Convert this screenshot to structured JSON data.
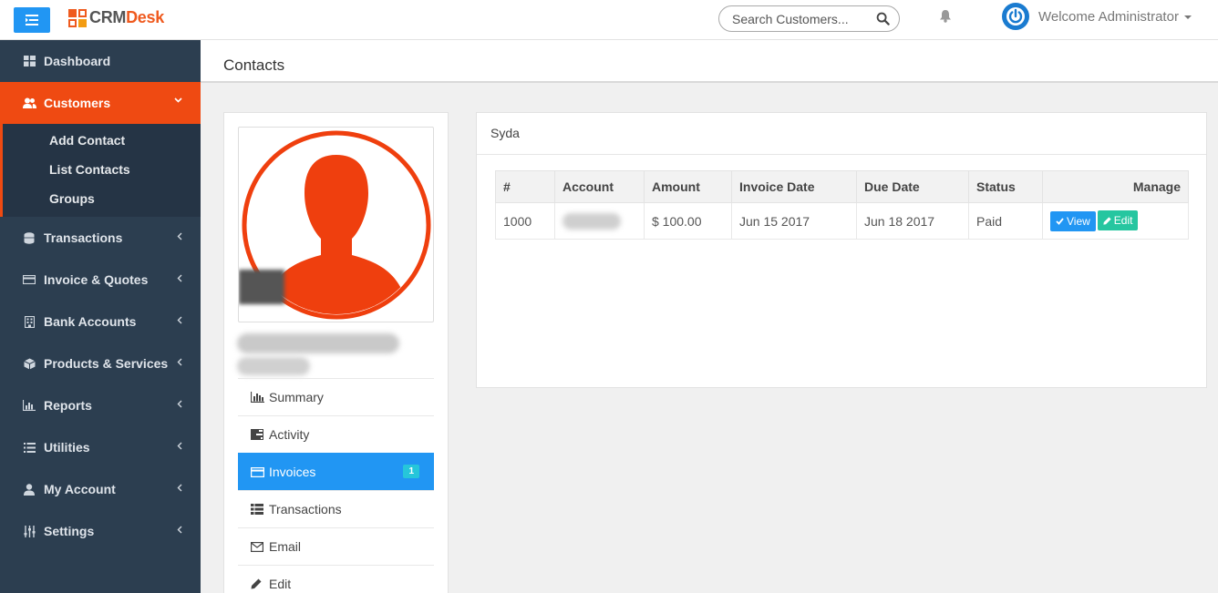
{
  "brand": {
    "part1": "CRM",
    "part2": "Desk"
  },
  "search": {
    "placeholder": "Search Customers..."
  },
  "user": {
    "welcome": "Welcome Administrator"
  },
  "sidebar": {
    "items": [
      {
        "label": "Dashboard",
        "icon": "dashboard-icon"
      },
      {
        "label": "Customers",
        "icon": "users-icon",
        "active": true
      },
      {
        "label": "Transactions",
        "icon": "database-icon"
      },
      {
        "label": "Invoice & Quotes",
        "icon": "credit-card-icon"
      },
      {
        "label": "Bank Accounts",
        "icon": "building-icon"
      },
      {
        "label": "Products & Services",
        "icon": "cube-icon"
      },
      {
        "label": "Reports",
        "icon": "bar-chart-icon"
      },
      {
        "label": "Utilities",
        "icon": "list-icon"
      },
      {
        "label": "My Account",
        "icon": "user-icon"
      },
      {
        "label": "Settings",
        "icon": "sliders-icon"
      }
    ],
    "submenu": [
      "Add Contact",
      "List Contacts",
      "Groups"
    ]
  },
  "page": {
    "title": "Contacts"
  },
  "profile": {
    "menu": [
      {
        "label": "Summary",
        "icon": "bar-chart-icon"
      },
      {
        "label": "Activity",
        "icon": "tasks-icon"
      },
      {
        "label": "Invoices",
        "icon": "credit-card-icon",
        "active": true,
        "badge": "1"
      },
      {
        "label": "Transactions",
        "icon": "table-icon"
      },
      {
        "label": "Email",
        "icon": "envelope-icon"
      },
      {
        "label": "Edit",
        "icon": "pencil-icon"
      }
    ]
  },
  "invoices": {
    "title": "Syda",
    "columns": [
      "#",
      "Account",
      "Amount",
      "Invoice Date",
      "Due Date",
      "Status",
      "Manage"
    ],
    "rows": [
      {
        "id": "1000",
        "amount": "$ 100.00",
        "invoice_date": "Jun 15 2017",
        "due_date": "Jun 18 2017",
        "status": "Paid"
      }
    ],
    "buttons": {
      "view": "View",
      "edit": "Edit"
    }
  },
  "colors": {
    "accent": "#ef4a12",
    "primary": "#2196f3",
    "sidebar": "#2c3e50",
    "teal": "#26c6da"
  }
}
